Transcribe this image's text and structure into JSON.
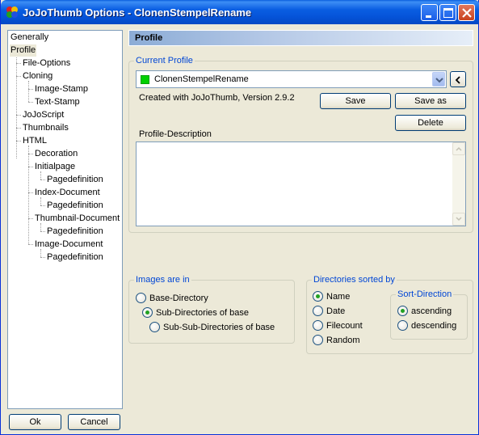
{
  "window": {
    "title": "JoJoThumb Options - ClonenStempelRename"
  },
  "tree": {
    "items": [
      {
        "label": "Generally",
        "level": 0
      },
      {
        "label": "Profile",
        "level": 0,
        "selected": true
      },
      {
        "label": "File-Options",
        "level": 1
      },
      {
        "label": "Cloning",
        "level": 1
      },
      {
        "label": "Image-Stamp",
        "level": 2
      },
      {
        "label": "Text-Stamp",
        "level": 2
      },
      {
        "label": "JoJoScript",
        "level": 1
      },
      {
        "label": "Thumbnails",
        "level": 1
      },
      {
        "label": "HTML",
        "level": 1
      },
      {
        "label": "Decoration",
        "level": 2
      },
      {
        "label": "Initialpage",
        "level": 2
      },
      {
        "label": "Pagedefinition",
        "level": 3
      },
      {
        "label": "Index-Document",
        "level": 2
      },
      {
        "label": "Pagedefinition",
        "level": 3
      },
      {
        "label": "Thumbnail-Document",
        "level": 2
      },
      {
        "label": "Pagedefinition",
        "level": 3
      },
      {
        "label": "Image-Document",
        "level": 2
      },
      {
        "label": "Pagedefinition",
        "level": 3
      }
    ]
  },
  "footer": {
    "ok_label": "Ok",
    "cancel_label": "Cancel"
  },
  "profile": {
    "header": "Profile",
    "current_profile_title": "Current Profile",
    "selected_profile": "ClonenStempelRename",
    "created_with": "Created with JoJoThumb, Version 2.9.2",
    "save_label": "Save",
    "save_as_label": "Save as",
    "delete_label": "Delete",
    "back_symbol": "<",
    "description_label": "Profile-Description",
    "description_value": ""
  },
  "images_are_in": {
    "title": "Images are in",
    "options": [
      "Base-Directory",
      "Sub-Directories of base",
      "Sub-Sub-Directories of base"
    ],
    "selected": "Sub-Directories of base"
  },
  "directories_sorted_by": {
    "title": "Directories sorted by",
    "options": [
      "Name",
      "Date",
      "Filecount",
      "Random"
    ],
    "selected": "Name"
  },
  "sort_direction": {
    "title": "Sort-Direction",
    "options": [
      "ascending",
      "descending"
    ],
    "selected": "ascending"
  },
  "colors": {
    "accent": "#0046d5",
    "profile_swatch": "#00d000",
    "radio_dot": "#21a121"
  }
}
